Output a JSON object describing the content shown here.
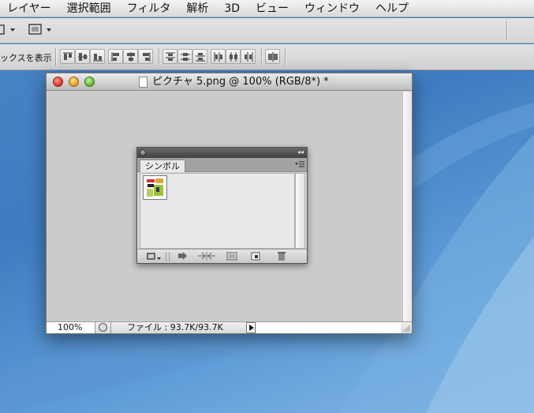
{
  "menubar": {
    "items": [
      "レイヤー",
      "選択範囲",
      "フィルタ",
      "解析",
      "3D",
      "ビュー",
      "ウィンドウ",
      "ヘルプ"
    ]
  },
  "optionbar": {
    "show_transform_label": "ックスを表示"
  },
  "document": {
    "title": "ピクチャ 5.png @ 100% (RGB/8*) *",
    "zoom": "100%",
    "file_info": "ファイル : 93.7K/93.7K"
  },
  "symbol_panel": {
    "tab_label": "シンボル"
  },
  "colors": {
    "desktop": "#4a84c4",
    "canvas": "#cbcbcb",
    "panel_title": "#404040"
  }
}
